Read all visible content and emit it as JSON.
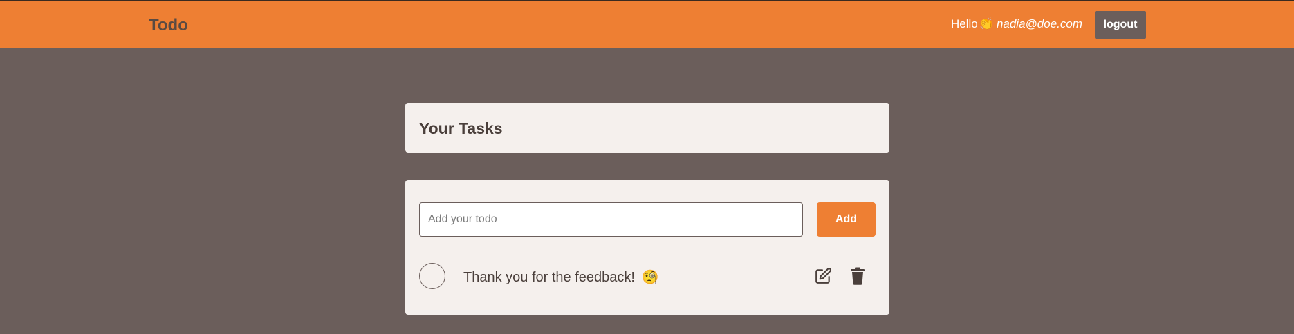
{
  "navbar": {
    "brand": "Todo",
    "greeting": "Hello",
    "greeting_emoji": "👏",
    "email": "nadia@doe.com",
    "logout_label": "logout"
  },
  "tasks_header": {
    "title": "Your Tasks"
  },
  "todo_form": {
    "placeholder": "Add your todo",
    "value": "",
    "add_label": "Add"
  },
  "tasks": [
    {
      "text": "Thank you for the feedback!",
      "emoji": "🧐",
      "completed": false
    }
  ],
  "colors": {
    "accent": "#ee7f33",
    "background": "#6b5e5b",
    "card": "#f5f0ed",
    "text": "#4a3f3b"
  }
}
